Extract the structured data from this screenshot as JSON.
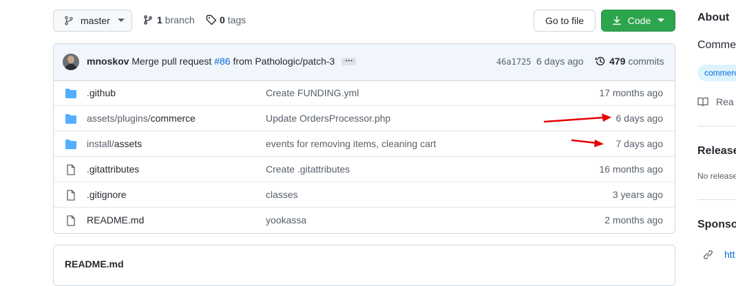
{
  "toolbar": {
    "branch_name": "master",
    "branch_count": "1",
    "branch_label": "branch",
    "tag_count": "0",
    "tag_label": "tags",
    "goto_file_label": "Go to file",
    "code_label": "Code"
  },
  "latest_commit": {
    "author": "mnoskov",
    "message_prefix": "Merge pull request",
    "pr_link": "#86",
    "message_suffix": "from Pathologic/patch-3",
    "ellipsis": "…",
    "hash": "46a1725",
    "age": "6 days ago",
    "commit_count": "479",
    "commit_label": "commits"
  },
  "files": [
    {
      "type": "dir",
      "prefix": "",
      "name": ".github",
      "message": "Create FUNDING.yml",
      "age": "17 months ago"
    },
    {
      "type": "dir",
      "prefix": "assets/plugins/",
      "name": "commerce",
      "message": "Update OrdersProcessor.php",
      "age": "6 days ago"
    },
    {
      "type": "dir",
      "prefix": "install/",
      "name": "assets",
      "message": "events for removing items, cleaning cart",
      "age": "7 days ago"
    },
    {
      "type": "file",
      "prefix": "",
      "name": ".gitattributes",
      "message": "Create .gitattributes",
      "age": "16 months ago"
    },
    {
      "type": "file",
      "prefix": "",
      "name": ".gitignore",
      "message": "classes",
      "age": "3 years ago"
    },
    {
      "type": "file",
      "prefix": "",
      "name": "README.md",
      "message": "yookassa",
      "age": "2 months ago"
    }
  ],
  "readme": {
    "title": "README.md"
  },
  "sidebar": {
    "about_heading": "About",
    "description": "Comme",
    "topic": "commerc",
    "readme_link": "Rea",
    "releases_heading": "Release",
    "releases_text": "No release",
    "sponsor_heading": "Sponso",
    "sponsor_link": "htt"
  },
  "colors": {
    "accent_green": "#2da44e",
    "link_blue": "#0969da",
    "folder_blue": "#54aeff",
    "annotation_red": "#e60000"
  }
}
